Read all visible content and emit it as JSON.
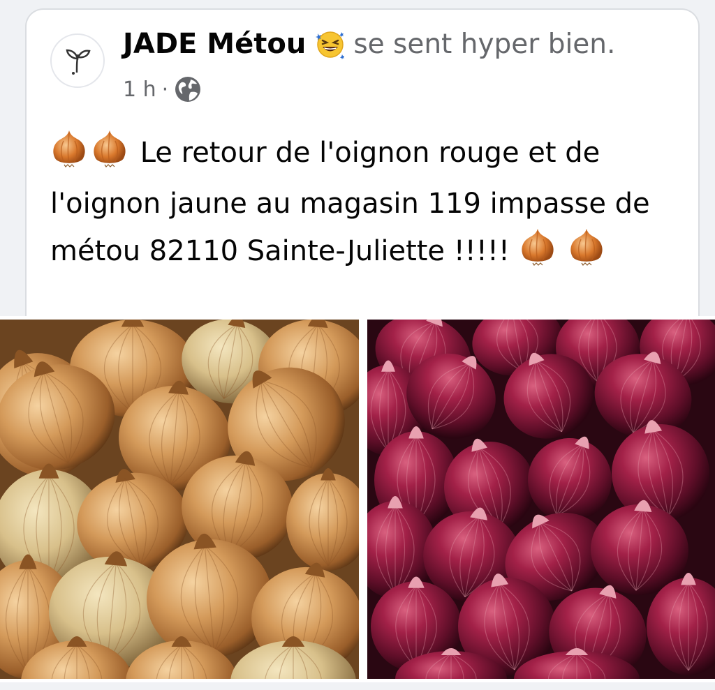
{
  "post": {
    "author": "JADE Métou",
    "feeling_emoji": "laughing-face-emoji",
    "feeling": "se sent hyper bien.",
    "time": "1 h",
    "separator": "·",
    "audience_icon": "globe-icon",
    "text_part1": "Le retour de l'oignon rouge et de l'oignon jaune au magasin 119 impasse de métou 82110 Sainte-Juliette !!!!!",
    "inline_emoji": "onion-emoji"
  },
  "photos": [
    {
      "subject": "yellow-onions"
    },
    {
      "subject": "red-onions"
    }
  ],
  "colors": {
    "background": "#f0f2f5",
    "card": "#ffffff",
    "text": "#050505",
    "secondary_text": "#65676b",
    "yellow_onion": "#c98a4a",
    "red_onion": "#6b1530"
  }
}
